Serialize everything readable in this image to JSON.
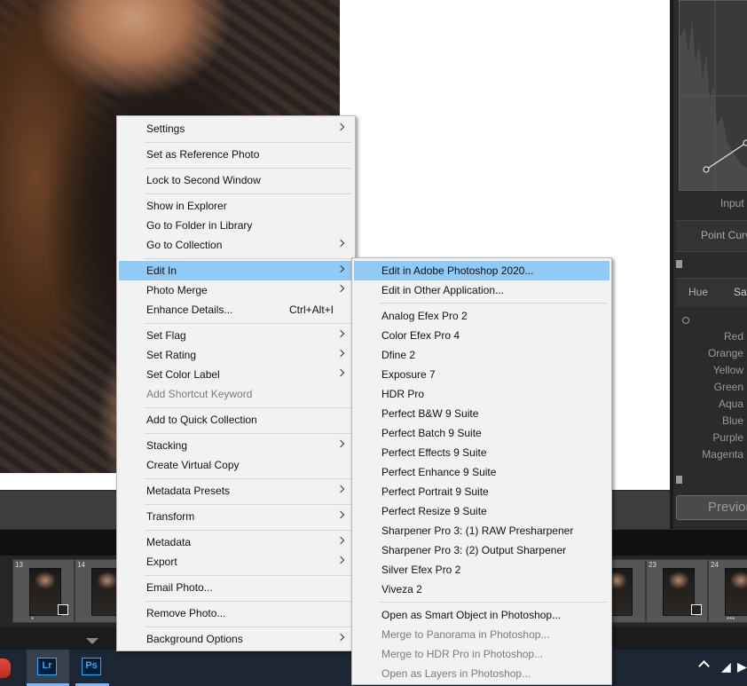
{
  "main_menu": {
    "items": [
      {
        "label": "Settings",
        "submenu": true
      },
      {
        "label": "Set as Reference Photo"
      },
      {
        "label": "Lock to Second Window"
      },
      {
        "label": "Show in Explorer"
      },
      {
        "label": "Go to Folder in Library"
      },
      {
        "label": "Go to Collection",
        "submenu": true
      },
      {
        "label": "Edit In",
        "submenu": true,
        "highlighted": true
      },
      {
        "label": "Photo Merge",
        "submenu": true
      },
      {
        "label": "Enhance Details...",
        "shortcut": "Ctrl+Alt+I"
      },
      {
        "label": "Set Flag",
        "submenu": true
      },
      {
        "label": "Set Rating",
        "submenu": true
      },
      {
        "label": "Set Color Label",
        "submenu": true
      },
      {
        "label": "Add Shortcut Keyword",
        "disabled": true
      },
      {
        "label": "Add to Quick Collection"
      },
      {
        "label": "Stacking",
        "submenu": true
      },
      {
        "label": "Create Virtual Copy"
      },
      {
        "label": "Metadata Presets",
        "submenu": true
      },
      {
        "label": "Transform",
        "submenu": true
      },
      {
        "label": "Metadata",
        "submenu": true
      },
      {
        "label": "Export",
        "submenu": true
      },
      {
        "label": "Email Photo..."
      },
      {
        "label": "Remove Photo..."
      },
      {
        "label": "Background Options",
        "submenu": true
      }
    ]
  },
  "edit_in_submenu": {
    "items": [
      {
        "label": "Edit in Adobe Photoshop 2020...",
        "highlighted": true
      },
      {
        "label": "Edit in Other Application..."
      },
      {
        "label": "Analog Efex Pro 2"
      },
      {
        "label": "Color Efex Pro 4"
      },
      {
        "label": "Dfine 2"
      },
      {
        "label": "Exposure 7"
      },
      {
        "label": "HDR Pro"
      },
      {
        "label": "Perfect B&W 9 Suite"
      },
      {
        "label": "Perfect Batch 9 Suite"
      },
      {
        "label": "Perfect Effects 9 Suite"
      },
      {
        "label": "Perfect Enhance 9 Suite"
      },
      {
        "label": "Perfect Portrait 9 Suite"
      },
      {
        "label": "Perfect Resize 9 Suite"
      },
      {
        "label": "Sharpener Pro 3: (1) RAW Presharpener"
      },
      {
        "label": "Sharpener Pro 3: (2) Output Sharpener"
      },
      {
        "label": "Silver Efex Pro 2"
      },
      {
        "label": "Viveza 2"
      },
      {
        "label": "Open as Smart Object in Photoshop..."
      },
      {
        "label": "Merge to Panorama in Photoshop...",
        "disabled": true
      },
      {
        "label": "Merge to HDR Pro in Photoshop...",
        "disabled": true
      },
      {
        "label": "Open as Layers in Photoshop...",
        "disabled": true
      }
    ]
  },
  "right_panel": {
    "curve_input_label": "Input",
    "point_curve_label": "Point Curv",
    "hsl_tabs": [
      "Hue",
      "Sat"
    ],
    "hsl_colors": [
      "Red",
      "Orange",
      "Yellow",
      "Green",
      "Aqua",
      "Blue",
      "Purple",
      "Magenta"
    ],
    "previous_button": "Previou"
  },
  "filmstrip": {
    "cells": [
      {
        "num": "13",
        "badge": true,
        "stars": "*"
      },
      {
        "num": "14",
        "badge": true,
        "stars": ""
      },
      {
        "num": "",
        "badge": false,
        "stars": ""
      },
      {
        "num": "23",
        "badge": true,
        "stars": ""
      },
      {
        "num": "24",
        "badge": false,
        "stars": "***"
      }
    ]
  },
  "taskbar": {
    "apps": [
      "Lr",
      "Ps"
    ]
  }
}
